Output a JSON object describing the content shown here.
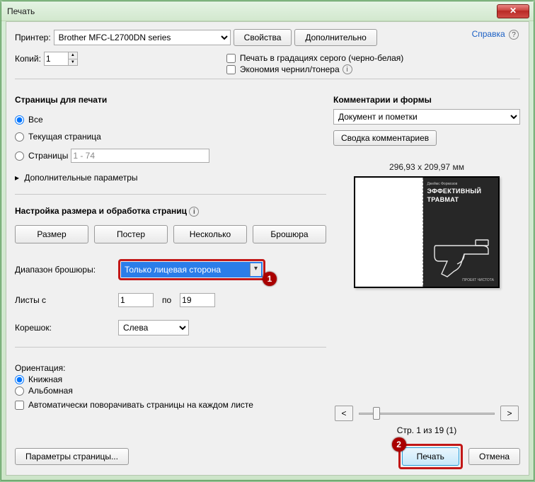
{
  "window": {
    "title": "Печать"
  },
  "help": {
    "label": "Справка"
  },
  "printer": {
    "label": "Принтер:",
    "selected": "Brother MFC-L2700DN series",
    "properties_btn": "Свойства",
    "advanced_btn": "Дополнительно"
  },
  "copies": {
    "label": "Копий:",
    "value": "1"
  },
  "options": {
    "grayscale": "Печать в градациях серого (черно-белая)",
    "ink_saver": "Экономия чернил/тонера"
  },
  "pages": {
    "title": "Страницы для печати",
    "all": "Все",
    "current": "Текущая страница",
    "range_label": "Страницы",
    "range_value": "1 - 74",
    "more": "Дополнительные параметры"
  },
  "sizing": {
    "title": "Настройка размера и обработка страниц",
    "size": "Размер",
    "poster": "Постер",
    "multiple": "Несколько",
    "booklet": "Брошюра"
  },
  "booklet": {
    "range_label": "Диапазон брошюры:",
    "range_selected": "Только лицевая сторона",
    "sheets_label": "Листы с",
    "from": "1",
    "to_label": "по",
    "to": "19",
    "bind_label": "Корешок:",
    "bind_selected": "Слева"
  },
  "orientation": {
    "title": "Ориентация:",
    "portrait": "Книжная",
    "landscape": "Альбомная",
    "autorotate": "Автоматически поворачивать страницы на каждом листе"
  },
  "comments": {
    "title": "Комментарии и формы",
    "selected": "Документ и пометки",
    "summary_btn": "Сводка комментариев"
  },
  "preview": {
    "dims": "296,93 x 209,97 мм",
    "cover_top": "Джеймс Формозов",
    "cover_big1": "ЭФФЕКТИВНЫЙ",
    "cover_big2": "ТРАВМАТ",
    "cover_bot": "ПРОЕКТ ЧИСТОТА",
    "page_of": "Стр. 1 из 19 (1)"
  },
  "callouts": {
    "one": "1",
    "two": "2"
  },
  "buttons": {
    "page_setup": "Параметры страницы...",
    "print": "Печать",
    "cancel": "Отмена"
  }
}
